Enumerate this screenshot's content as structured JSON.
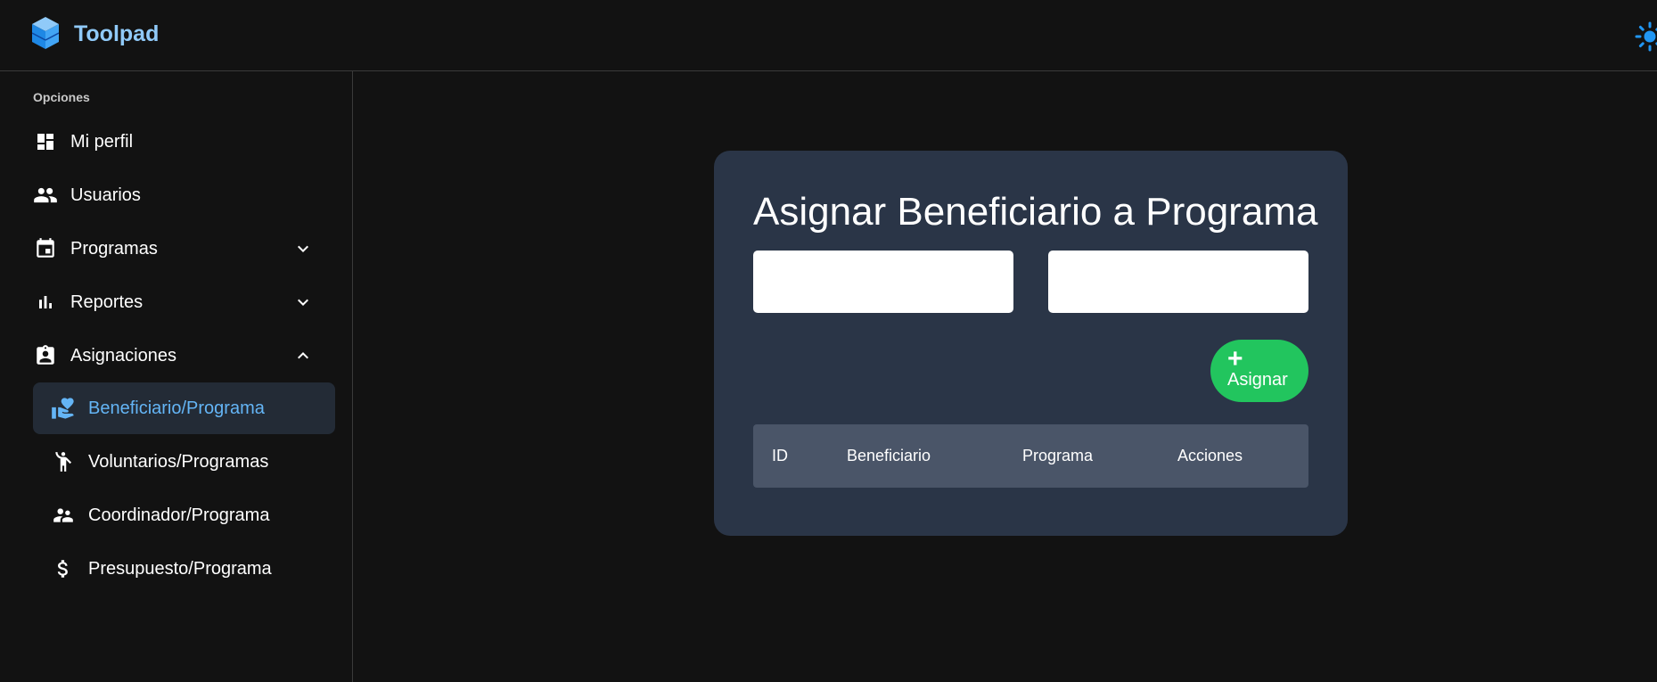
{
  "header": {
    "app_title": "Toolpad",
    "logo_icon": "toolpad-cube-icon",
    "theme_icon": "sun-icon",
    "colors": {
      "title": "#90caf9",
      "accent": "#2196f3"
    }
  },
  "sidebar": {
    "section_label": "Opciones",
    "items": [
      {
        "label": "Mi perfil",
        "icon": "dashboard-icon"
      },
      {
        "label": "Usuarios",
        "icon": "people-icon"
      },
      {
        "label": "Programas",
        "icon": "calendar-icon",
        "expandable": true,
        "expanded": false
      },
      {
        "label": "Reportes",
        "icon": "bar-chart-icon",
        "expandable": true,
        "expanded": false
      },
      {
        "label": "Asignaciones",
        "icon": "assignment-ind-icon",
        "expandable": true,
        "expanded": true
      }
    ],
    "sub_items": [
      {
        "label": "Beneficiario/Programa",
        "icon": "volunteer-activism-icon",
        "active": true
      },
      {
        "label": "Voluntarios/Programas",
        "icon": "person-raised-hand-icon"
      },
      {
        "label": "Coordinador/Programa",
        "icon": "supervisor-icon"
      },
      {
        "label": "Presupuesto/Programa",
        "icon": "dollar-icon"
      }
    ],
    "active_color": "#64b5f6"
  },
  "main": {
    "title": "Asignar Beneficiario a Programa",
    "beneficiary_select": {
      "value": ""
    },
    "program_select": {
      "value": ""
    },
    "assign_button": {
      "icon": "plus-icon",
      "label": "Asignar",
      "color": "#22c55e"
    },
    "table": {
      "columns": [
        "ID",
        "Beneficiario",
        "Programa",
        "Acciones"
      ],
      "rows": []
    }
  }
}
